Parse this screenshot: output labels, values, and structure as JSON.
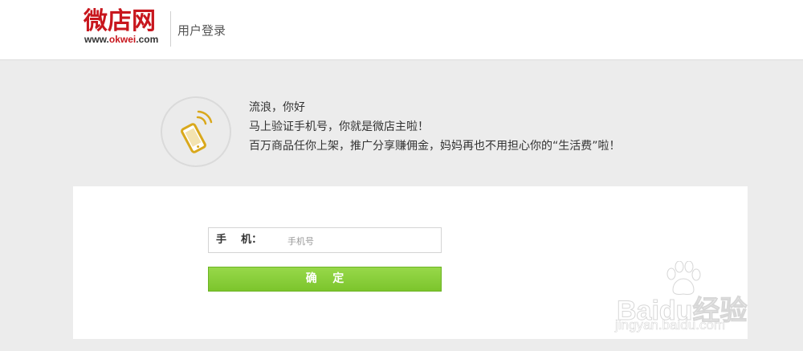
{
  "header": {
    "logo_text": "微店网",
    "logo_url_prefix": "www.",
    "logo_url_brand": "okwei",
    "logo_url_suffix": ".com",
    "page_title": "用户登录"
  },
  "greeting": {
    "icon": "mobile-phone-icon",
    "line1": "流浪，你好",
    "line2": "马上验证手机号，你就是微店主啦！",
    "line3": "百万商品任你上架，推广分享赚佣金，妈妈再也不用担心你的“生活费”啦！"
  },
  "form": {
    "phone_label": "手    机：",
    "phone_value": "",
    "phone_placeholder": "手机号",
    "confirm_label": "确    定"
  },
  "watermark": {
    "brand": "Baidu经验",
    "url": "jingyan.baidu.com"
  },
  "colors": {
    "brand_red": "#c8161d",
    "button_green": "#85cc37",
    "icon_gold": "#d9a81c"
  }
}
